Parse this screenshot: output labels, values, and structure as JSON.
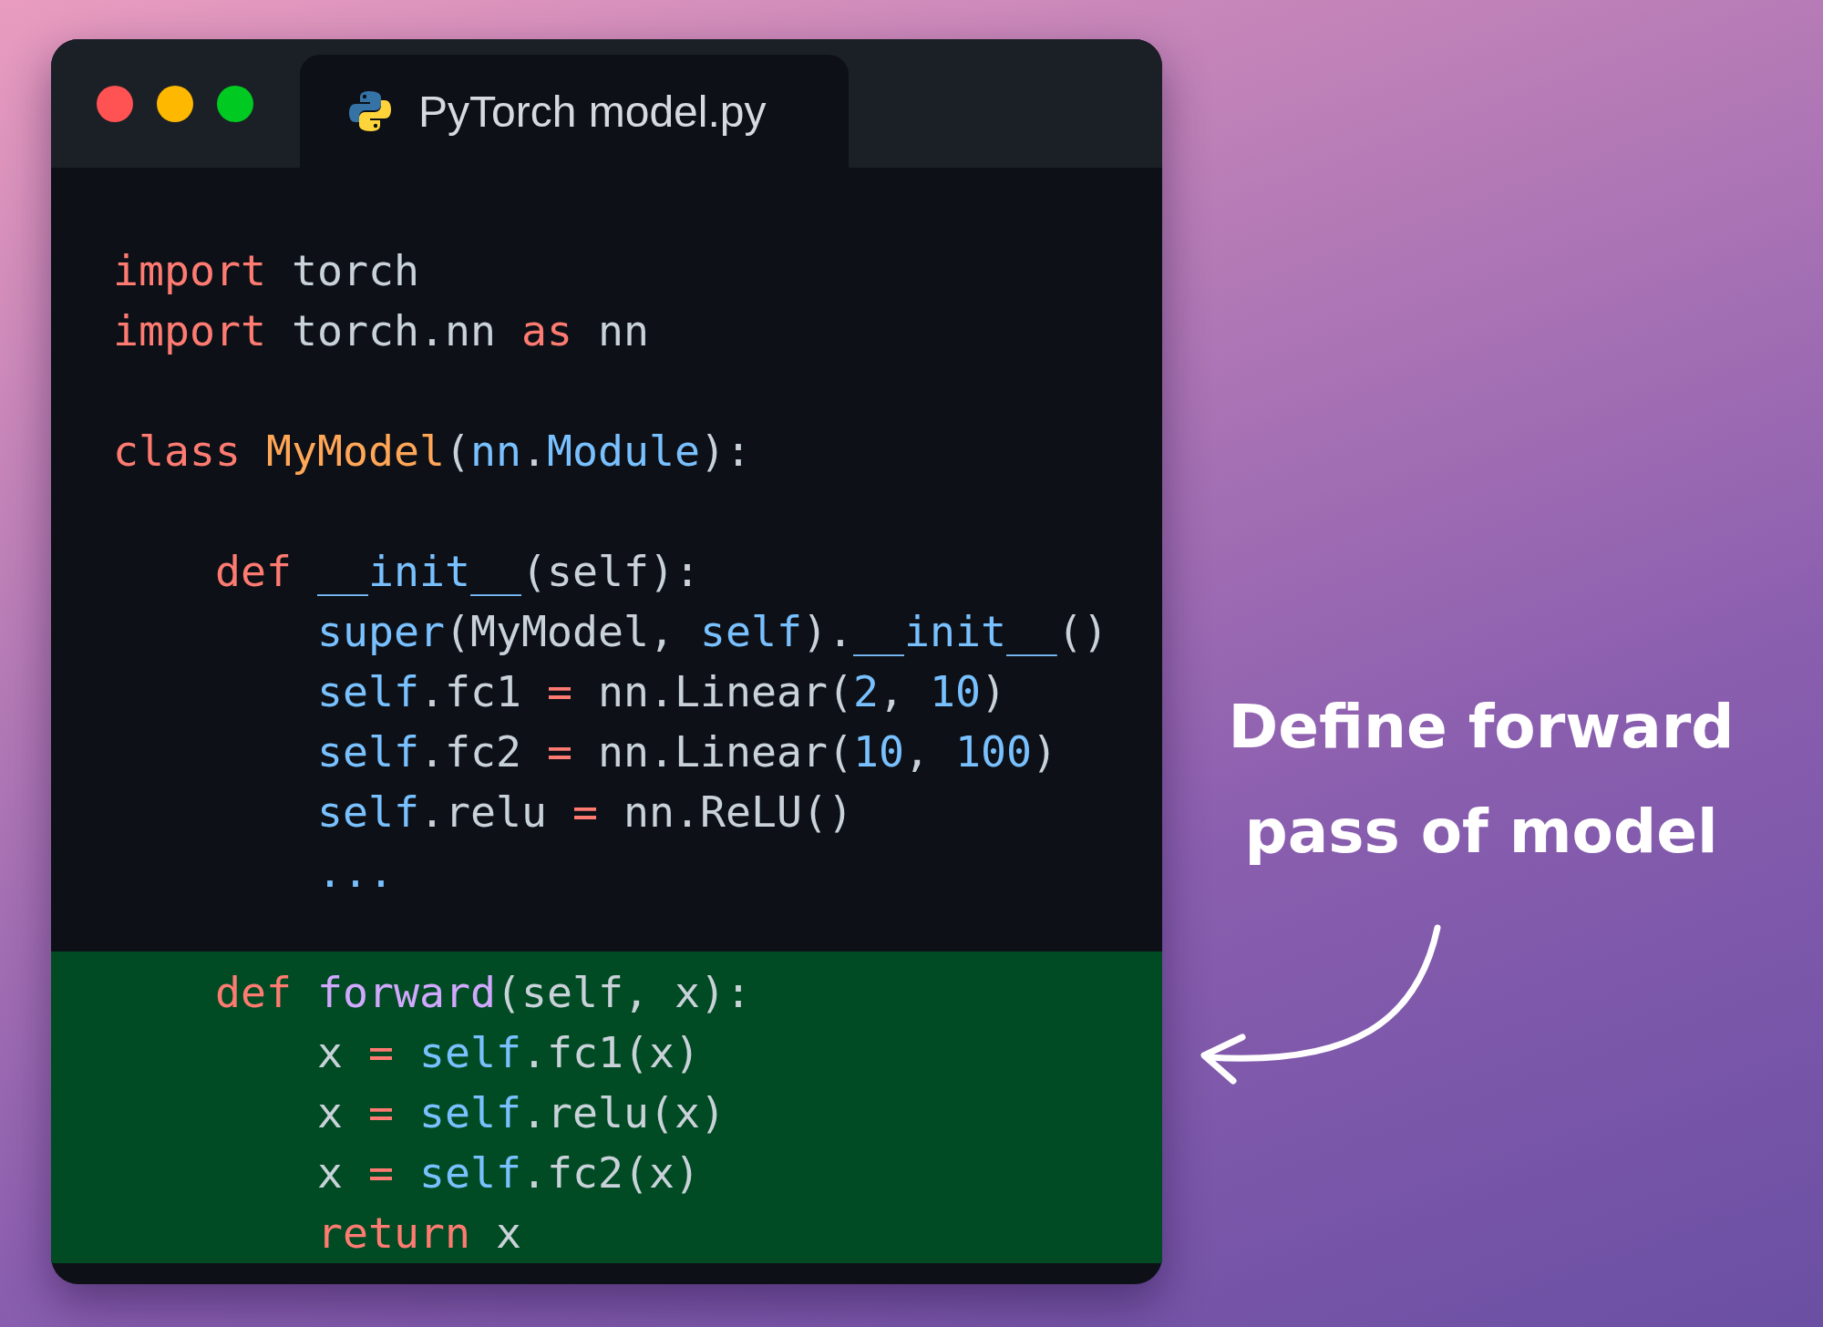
{
  "window": {
    "traffic_lights": [
      {
        "color": "#ff5252"
      },
      {
        "color": "#ffb800"
      },
      {
        "color": "#00c922"
      }
    ],
    "tab": {
      "title": "PyTorch model.py",
      "selected": true
    }
  },
  "code": {
    "blocks": [
      {
        "highlighted": false,
        "lines": [
          [
            {
              "kind": "keyword",
              "text": "import"
            },
            {
              "kind": "plain",
              "text": " torch"
            }
          ],
          [
            {
              "kind": "keyword",
              "text": "import"
            },
            {
              "kind": "plain",
              "text": " torch.nn "
            },
            {
              "kind": "keyword",
              "text": "as"
            },
            {
              "kind": "plain",
              "text": " nn"
            }
          ]
        ]
      },
      {
        "highlighted": false,
        "lines": [
          [
            {
              "kind": "keyword",
              "text": "class "
            },
            {
              "kind": "class",
              "text": "MyModel"
            },
            {
              "kind": "plain",
              "text": "("
            },
            {
              "kind": "builtin",
              "text": "nn"
            },
            {
              "kind": "plain",
              "text": "."
            },
            {
              "kind": "builtin",
              "text": "Module"
            },
            {
              "kind": "plain",
              "text": "):"
            }
          ]
        ]
      },
      {
        "highlighted": false,
        "lines": [
          [
            {
              "kind": "keyword",
              "text": "    def "
            },
            {
              "kind": "builtin",
              "text": "__init__"
            },
            {
              "kind": "plain",
              "text": "(self):"
            }
          ],
          [
            {
              "kind": "builtin",
              "text": "        super"
            },
            {
              "kind": "plain",
              "text": "(MyModel, "
            },
            {
              "kind": "builtin",
              "text": "self"
            },
            {
              "kind": "plain",
              "text": ")."
            },
            {
              "kind": "builtin",
              "text": "__init__"
            },
            {
              "kind": "plain",
              "text": "()"
            }
          ],
          [
            {
              "kind": "builtin",
              "text": "        self"
            },
            {
              "kind": "plain",
              "text": ".fc1 "
            },
            {
              "kind": "keyword",
              "text": "="
            },
            {
              "kind": "plain",
              "text": " nn.Linear("
            },
            {
              "kind": "number",
              "text": "2"
            },
            {
              "kind": "plain",
              "text": ", "
            },
            {
              "kind": "number",
              "text": "10"
            },
            {
              "kind": "plain",
              "text": ")"
            }
          ],
          [
            {
              "kind": "builtin",
              "text": "        self"
            },
            {
              "kind": "plain",
              "text": ".fc2 "
            },
            {
              "kind": "keyword",
              "text": "="
            },
            {
              "kind": "plain",
              "text": " nn.Linear("
            },
            {
              "kind": "number",
              "text": "10"
            },
            {
              "kind": "plain",
              "text": ", "
            },
            {
              "kind": "number",
              "text": "100"
            },
            {
              "kind": "plain",
              "text": ")"
            }
          ],
          [
            {
              "kind": "builtin",
              "text": "        self"
            },
            {
              "kind": "plain",
              "text": ".relu "
            },
            {
              "kind": "keyword",
              "text": "="
            },
            {
              "kind": "plain",
              "text": " nn.ReLU()"
            }
          ],
          [
            {
              "kind": "builtin",
              "text": "        ..."
            }
          ]
        ]
      },
      {
        "highlighted": true,
        "lines": [
          [
            {
              "kind": "keyword",
              "text": "    def "
            },
            {
              "kind": "function",
              "text": "forward"
            },
            {
              "kind": "plain",
              "text": "(self, x):"
            }
          ],
          [
            {
              "kind": "plain",
              "text": "        x "
            },
            {
              "kind": "keyword",
              "text": "="
            },
            {
              "kind": "builtin",
              "text": " self"
            },
            {
              "kind": "plain",
              "text": ".fc1(x)"
            }
          ],
          [
            {
              "kind": "plain",
              "text": "        x "
            },
            {
              "kind": "keyword",
              "text": "="
            },
            {
              "kind": "builtin",
              "text": " self"
            },
            {
              "kind": "plain",
              "text": ".relu(x)"
            }
          ],
          [
            {
              "kind": "plain",
              "text": "        x "
            },
            {
              "kind": "keyword",
              "text": "="
            },
            {
              "kind": "builtin",
              "text": " self"
            },
            {
              "kind": "plain",
              "text": ".fc2(x)"
            }
          ],
          [
            {
              "kind": "keyword",
              "text": "        return"
            },
            {
              "kind": "plain",
              "text": " x"
            }
          ]
        ]
      }
    ]
  },
  "annotation": {
    "lines": [
      "Define forward",
      "pass of model"
    ]
  }
}
